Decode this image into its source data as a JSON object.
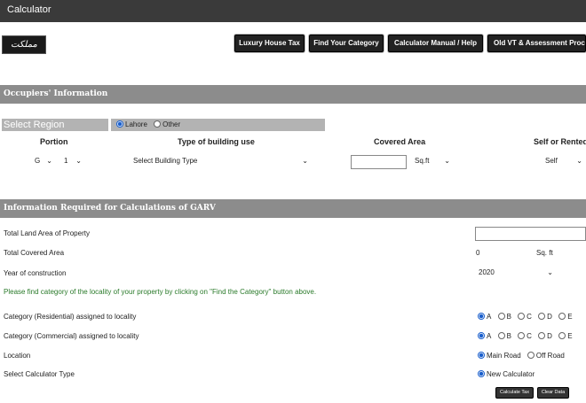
{
  "window": {
    "title": "Calculator"
  },
  "logo_text": "ﻣﻤﻠﮑﺖ",
  "toolbar": {
    "luxury_house_tax": "Luxury House Tax",
    "find_category": "Find Your Category",
    "calculator_manual": "Calculator Manual / Help",
    "old_vt": "Old VT & Assessment Procedure"
  },
  "occupiers": {
    "heading": "Occupiers' Information",
    "select_region_label": "Select Region",
    "region_options": [
      "Lahore",
      "Other"
    ],
    "region_selected": "Lahore",
    "columns": {
      "portion": "Portion",
      "building_use": "Type of building use",
      "covered_area": "Covered Area",
      "self_or_rented": "Self or Rented"
    },
    "portion_floor": "G",
    "portion_number": "1",
    "building_type": "Select Building Type",
    "covered_area_value": "",
    "covered_area_unit": "Sq.ft",
    "self_or_rented_value": "Self"
  },
  "garv": {
    "heading": "Information Required for Calculations of GARV",
    "land_area_label": "Total Land Area of Property",
    "land_area_value": "",
    "covered_area_label": "Total Covered Area",
    "covered_area_value": "0",
    "covered_area_unit": "Sq. ft",
    "year_label": "Year of construction",
    "year_value": "2020",
    "note": "Please find category of the locality of your property by clicking on \"Find the Category\" button above.",
    "residential_label": "Category (Residential) assigned to locality",
    "commercial_label": "Category (Commercial) assigned to locality",
    "category_options": [
      "A",
      "B",
      "C",
      "D",
      "E"
    ],
    "residential_selected": "A",
    "commercial_selected": "A",
    "location_label": "Location",
    "location_options": [
      "Main Road",
      "Off Road"
    ],
    "location_selected": "Main Road",
    "calc_type_label": "Select Calculator Type",
    "calc_type_option": "New Calculator",
    "calculate_button": "Calculate Tax",
    "clear_button": "Clear Data"
  }
}
